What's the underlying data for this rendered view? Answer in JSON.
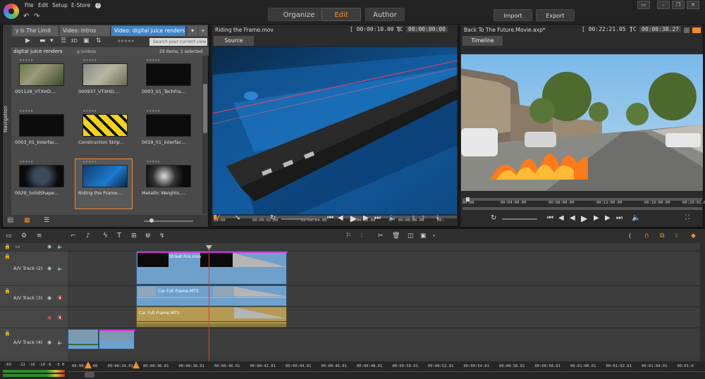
{
  "menu": {
    "file": "File",
    "edit": "Edit",
    "setup": "Setup",
    "estore": "E-Store",
    "help": "?"
  },
  "modes": {
    "organize": "Organize",
    "edit": "Edit",
    "author": "Author"
  },
  "actions": {
    "import": "Import",
    "export": "Export"
  },
  "library": {
    "nav_label": "Navigation",
    "tabs": [
      "y Is The Limit",
      "Video: Intros",
      "Video: digital juice renders"
    ],
    "search_placeholder": "Search your current view",
    "mode_3d": "3D",
    "folder_title": "digital juice renders",
    "path": "g:\\videos",
    "items_info": "29 items, 1 selected",
    "items": [
      {
        "label": "001128_VTXHD....",
        "kind": "outdoor"
      },
      {
        "label": "000937_VTXHD....",
        "kind": "outdoor2"
      },
      {
        "label": "0003_01_TechFra...",
        "kind": "dark"
      },
      {
        "label": "0003_01_Interfac...",
        "kind": "dark"
      },
      {
        "label": "Construction Strip...",
        "kind": "yellow"
      },
      {
        "label": "0019_01_interfac...",
        "kind": "dark"
      },
      {
        "label": "0029_SolidShape...",
        "kind": "frame"
      },
      {
        "label": "Riding the Frame....",
        "kind": "blue",
        "selected": true
      },
      {
        "label": "Metallic Weights....",
        "kind": "metal"
      }
    ]
  },
  "source_preview": {
    "title": "Riding the Frame.mov",
    "duration": "00:00:10.00",
    "tc_label": "TC",
    "timecode": "00:00:00:00",
    "tab": "Source",
    "ruler": [
      "00:00",
      "00:00:02.00",
      "00:00:04.00",
      "00:00:06.00",
      "00:00:08.00",
      "00:"
    ]
  },
  "timeline_preview": {
    "title": "Back To The Future.Movie.axp*",
    "duration": "00:22:21.05",
    "tc_label": "TC",
    "timecode": "00:00:38.27",
    "tab": "Timeline",
    "ruler": [
      "00:00",
      "00:04:00.00",
      "00:08:00.00",
      "00:12:00.00",
      "00:16:00.00",
      "00:20:01.00"
    ]
  },
  "tracks": [
    {
      "label": "A/V Track (2)"
    },
    {
      "label": "A/V Track (3)"
    },
    {
      "label": "A/V Track (4)"
    }
  ],
  "clips": {
    "street_fire": "Street Fire.mov",
    "car_video": "Car Full Frame.MTS",
    "car_audio": "Car Full Frame.MTS"
  },
  "timeline_ruler": [
    "00:00:32.00",
    "00:00:34.01",
    "00:00:36.01",
    "00:00:38.01",
    "00:00:40.01",
    "00:00:42.01",
    "00:00:44.01",
    "00:00:46.01",
    "00:00:48.01",
    "00:00:50.01",
    "00:00:52.01",
    "00:00:54.01",
    "00:00:56.01",
    "00:00:58.01",
    "00:01:00.01",
    "00:01:02.01",
    "00:01:04.01",
    "00:01:0"
  ],
  "meter_labels": [
    "-60",
    "-22",
    "-16",
    "-10",
    "-6",
    "-3",
    "0"
  ],
  "colors": {
    "accent": "#f28d2b",
    "tab_active": "#3f84c9",
    "playhead": "#e03a3a",
    "clip_blue": "#6ea0cc",
    "clip_gold": "#b49a52"
  }
}
